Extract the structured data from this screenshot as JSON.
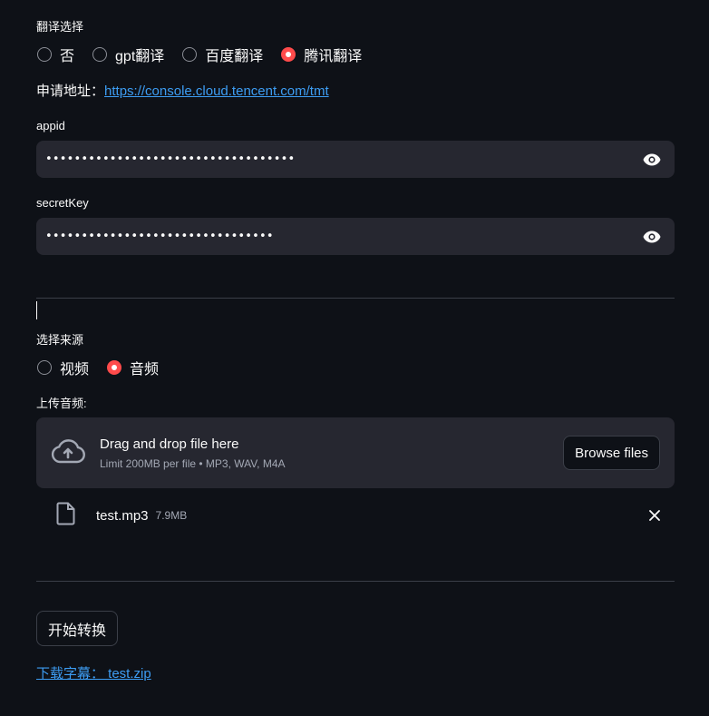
{
  "translation": {
    "label": "翻译选择",
    "options": [
      "否",
      "gpt翻译",
      "百度翻译",
      "腾讯翻译"
    ],
    "selected_index": 3
  },
  "apply": {
    "prefix": "申请地址：",
    "url_text": "https://console.cloud.tencent.com/tmt"
  },
  "appid": {
    "label": "appid",
    "masked_value": "•••••••••••••••••••••••••••••••••••"
  },
  "secret_key": {
    "label": "secretKey",
    "masked_value": "••••••••••••••••••••••••••••••••"
  },
  "source": {
    "label": "选择来源",
    "options": [
      "视频",
      "音频"
    ],
    "selected_index": 1
  },
  "upload": {
    "label": "上传音频:",
    "drop_title": "Drag and drop file here",
    "drop_subtitle": "Limit 200MB per file • MP3, WAV, M4A",
    "browse_label": "Browse files",
    "file_name": "test.mp3",
    "file_size": "7.9MB"
  },
  "start_button": "开始转换",
  "download_link": "下载字幕： test.zip",
  "colors": {
    "background": "#0e1117",
    "input_bg": "#262730",
    "accent_radio": "#ff4b4b",
    "link": "#3d9df3",
    "divider": "#3b3f48"
  },
  "icons": [
    "eye-icon",
    "cloud-upload-icon",
    "file-icon",
    "close-icon"
  ]
}
